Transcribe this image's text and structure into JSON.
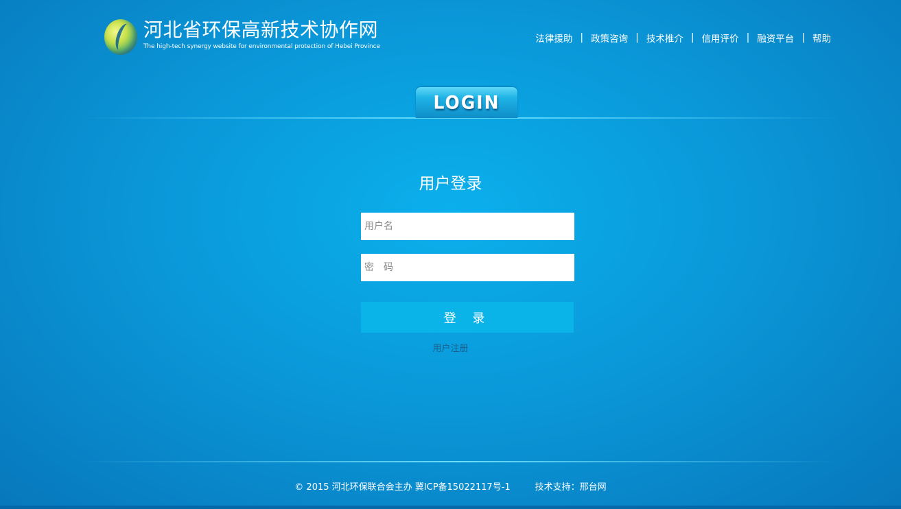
{
  "header": {
    "logo_title": "河北省环保高新技术协作网",
    "logo_subtitle": "The high-tech synergy  website for environmental protection of Hebei Province"
  },
  "nav": {
    "items": [
      "法律援助",
      "政策咨询",
      "技术推介",
      "信用评价",
      "融资平台",
      "帮助"
    ],
    "separator": "|"
  },
  "login_tab": {
    "label": "LOGIN"
  },
  "form": {
    "title": "用户登录",
    "username_placeholder": "用户名",
    "password_placeholder": "密　码",
    "submit_label": "登 录",
    "register_link": "用户注册"
  },
  "footer": {
    "copyright": "© 2015 河北环保联合会主办   冀ICP备15022117号-1",
    "support": "技术支持：邢台网"
  },
  "colors": {
    "background": "#0a97d8",
    "button": "#0ab3e8",
    "register_link": "#1a5f8c"
  },
  "icons": {
    "logo": "leaf-s-logo-icon"
  }
}
